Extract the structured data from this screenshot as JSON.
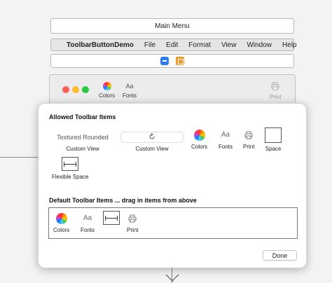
{
  "main_menu": {
    "label": "Main Menu"
  },
  "menubar": {
    "items": [
      "ToolbarButtonDemo",
      "File",
      "Edit",
      "Format",
      "View",
      "Window",
      "Help"
    ]
  },
  "icon_strip": {
    "icons": [
      "window-icon",
      "cube-icon"
    ]
  },
  "window_preview": {
    "toolbar": [
      {
        "icon": "color-wheel-icon",
        "label": "Colors"
      },
      {
        "icon": "fonts-icon",
        "glyph": "Aa",
        "label": "Fonts"
      },
      {
        "icon": "print-icon",
        "label": "Print"
      }
    ]
  },
  "sheet": {
    "allowed_title": "Allowed Toolbar Items",
    "default_title": "Default Toolbar Items ... drag in items from above",
    "allowed_items": {
      "textured_rounded": {
        "control_text": "Textured Rounded",
        "label": "Custom View"
      },
      "custom_view": {
        "label": "Custom View"
      },
      "colors": {
        "label": "Colors"
      },
      "fonts": {
        "glyph": "Aa",
        "label": "Fonts"
      },
      "print": {
        "label": "Print"
      },
      "space": {
        "label": "Space"
      },
      "flexible_space": {
        "label": "Flexible Space"
      }
    },
    "default_items": {
      "colors": {
        "label": "Colors"
      },
      "fonts": {
        "glyph": "Aa",
        "label": "Fonts"
      },
      "print": {
        "label": "Print"
      }
    },
    "done_label": "Done"
  }
}
